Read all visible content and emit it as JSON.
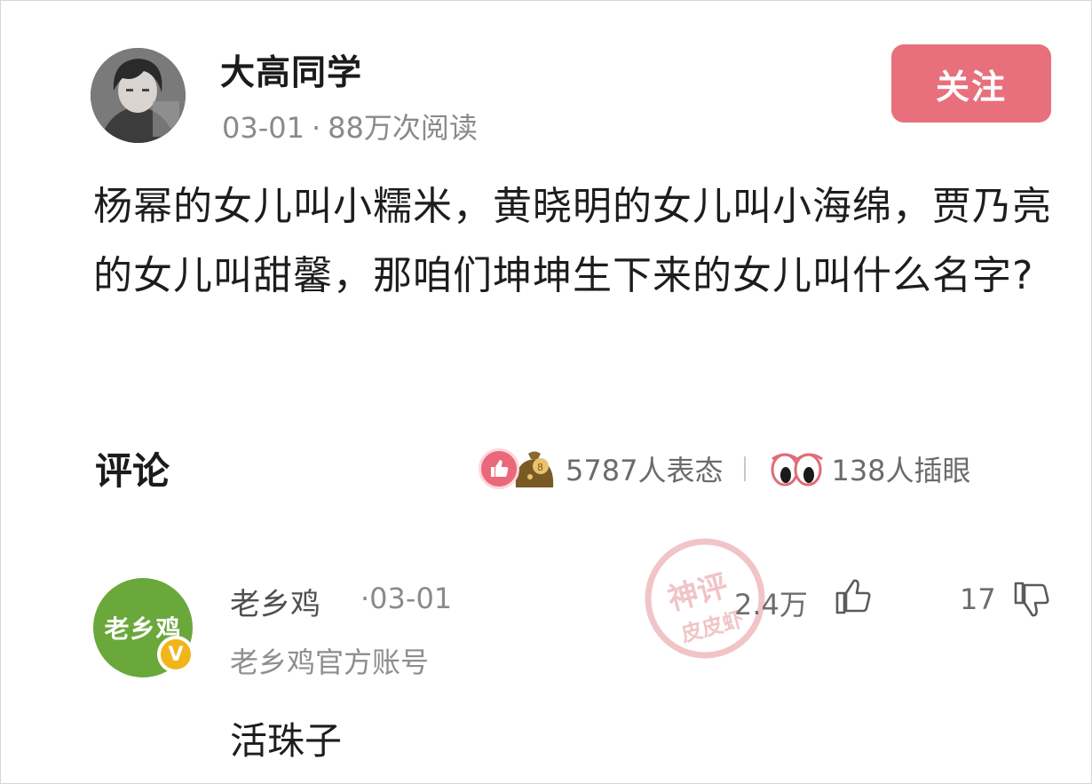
{
  "post": {
    "author_name": "大高同学",
    "date": "03-01",
    "separator": "·",
    "views": "88万次阅读",
    "follow_label": "关注",
    "text": "杨幂的女儿叫小糯米，黄晓明的女儿叫小海绵，贾乃亮的女儿叫甜馨，那咱们坤坤生下来的女儿叫什么名字?"
  },
  "comments_header": {
    "title": "评论",
    "reactions_count": "5787人表态",
    "peek_count": "138人插眼"
  },
  "comment": {
    "avatar_text": "老乡鸡",
    "verified_badge": "V",
    "author_name": "老乡鸡",
    "date": "03-01",
    "author_desc": "老乡鸡官方账号",
    "text": "活珠子",
    "likes": "2.4万",
    "dislikes": "17"
  },
  "watermark": {
    "line1": "神评",
    "line2": "皮皮虾"
  },
  "colors": {
    "follow_button": "#e8707c",
    "commenter_avatar": "#6aa83c",
    "verified_badge": "#f1b51a",
    "watermark": "#d0303a"
  },
  "icons": {
    "author_avatar": "anime-character-avatar",
    "like_reaction": "thumbs-up-reaction-icon",
    "bag_reaction": "money-bag-reaction-icon",
    "eyes": "peeking-eyes-icon",
    "comment_like": "thumbs-up-icon",
    "comment_dislike": "thumbs-down-icon"
  }
}
